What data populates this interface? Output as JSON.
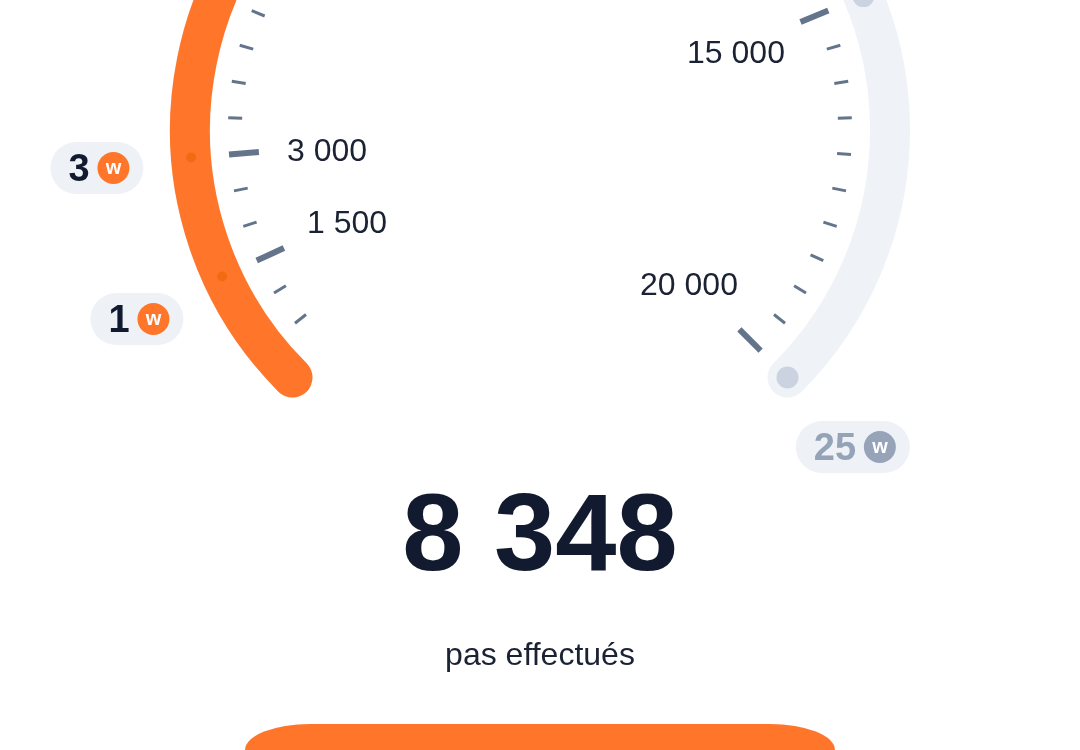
{
  "gauge": {
    "scale_labels": [
      "1 500",
      "3 000",
      "15 000",
      "20 000"
    ],
    "milestones": [
      {
        "reward": "1",
        "coin": "w",
        "reached": true
      },
      {
        "reward": "3",
        "coin": "w",
        "reached": true
      },
      {
        "reached": false
      },
      {
        "reward": "25",
        "coin": "w",
        "reached": false
      }
    ]
  },
  "steps": {
    "value": "8 348",
    "caption": "pas effectués"
  }
}
